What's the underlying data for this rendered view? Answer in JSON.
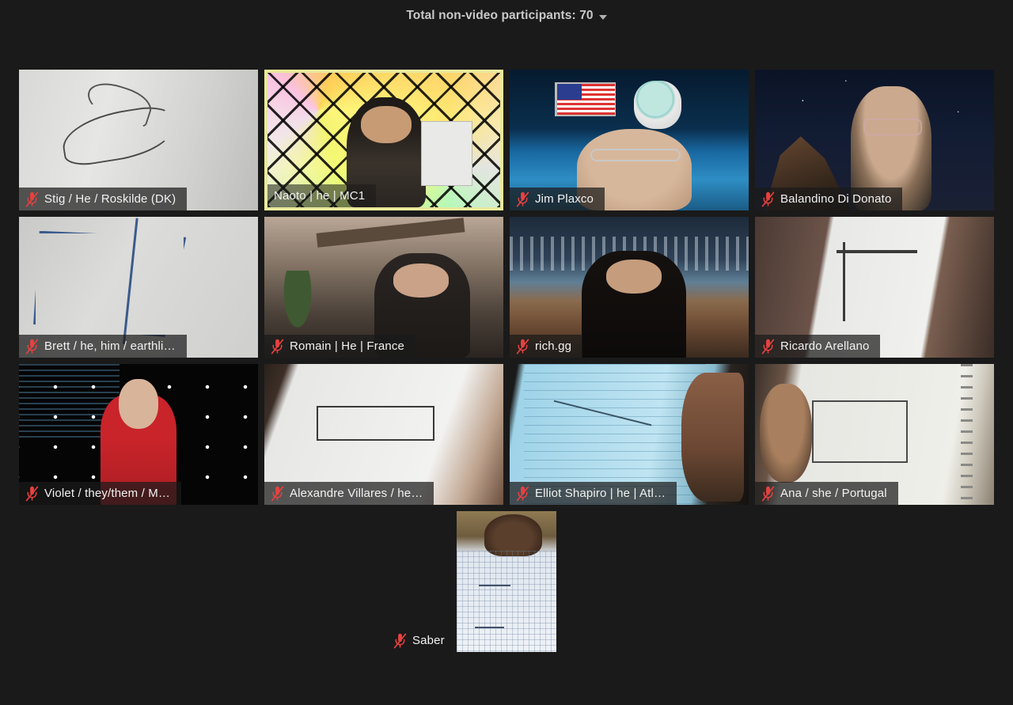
{
  "header": {
    "label": "Total non-video participants: 70",
    "dropdown_icon": "chevron-down-icon"
  },
  "theme": {
    "background": "#1a1a1a",
    "active_speaker_border": "#e9e99c",
    "label_text": "#f2f2f2",
    "header_text": "#c9c9c9",
    "mute_icon_color": "#e8413f"
  },
  "gallery": {
    "rows": [
      {
        "tiles": [
          {
            "name": "Stig / He / Roskilde (DK)",
            "muted": true,
            "active_speaker": false,
            "video_class": "v-stig"
          },
          {
            "name": "Naoto | he | MC1",
            "muted": false,
            "active_speaker": true,
            "video_class": "v-naoto"
          },
          {
            "name": "Jim Plaxco",
            "muted": true,
            "active_speaker": false,
            "video_class": "v-jim"
          },
          {
            "name": "Balandino Di Donato",
            "muted": true,
            "active_speaker": false,
            "video_class": "v-bala"
          }
        ]
      },
      {
        "tiles": [
          {
            "name": "Brett / he, him / earthli…",
            "muted": true,
            "active_speaker": false,
            "video_class": "v-brett"
          },
          {
            "name": "Romain | He | France",
            "muted": true,
            "active_speaker": false,
            "video_class": "v-romain"
          },
          {
            "name": "rich.gg",
            "muted": true,
            "active_speaker": false,
            "video_class": "v-rich"
          },
          {
            "name": "Ricardo Arellano",
            "muted": true,
            "active_speaker": false,
            "video_class": "v-ricardo"
          }
        ]
      },
      {
        "tiles": [
          {
            "name": "Violet / they/them / M…",
            "muted": true,
            "active_speaker": false,
            "video_class": "v-violet"
          },
          {
            "name": "Alexandre Villares / he…",
            "muted": true,
            "active_speaker": false,
            "video_class": "v-alex"
          },
          {
            "name": "Elliot Shapiro | he | Atl…",
            "muted": true,
            "active_speaker": false,
            "video_class": "v-elliot"
          },
          {
            "name": "Ana / she / Portugal",
            "muted": true,
            "active_speaker": false,
            "video_class": "v-ana"
          }
        ]
      },
      {
        "tiles": [
          {
            "name": "Saber",
            "muted": true,
            "active_speaker": false,
            "video_class": "v-saber",
            "letterboxed": true
          }
        ]
      }
    ]
  }
}
